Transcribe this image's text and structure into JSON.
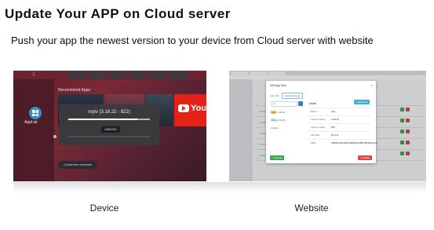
{
  "header": {
    "title": "Update Your APP on Cloud server",
    "subtitle": "Push your app the newest version to your device from Cloud server with website"
  },
  "device": {
    "caption": "Device",
    "applist_label": "AppList",
    "recommended_label": "Recommend Apps",
    "dialog": {
      "title": "mytv (3.18.22 - 822)",
      "cancel_label": "CANCEL",
      "progress": 0.85
    },
    "youtube_text": "YouT",
    "customize_label": "Customize channels"
  },
  "website": {
    "caption": "Website",
    "modal": {
      "title": "Edit App Item",
      "close": "×",
      "tabs": [
        "App Info",
        "Install Manager"
      ],
      "search_placeholder": "Al",
      "list": [
        {
          "badge": "App",
          "value": "2.18.22"
        },
        {
          "badge": "Test",
          "value": "2.18.22"
        },
        {
          "badge": "",
          "value": "2 items"
        }
      ],
      "detail_head": "Detail",
      "add_label": "+ Add New",
      "details": [
        {
          "k": "Mode",
          "v": "App"
        },
        {
          "k": "Version Name",
          "v": "3.18.22"
        },
        {
          "k": "Version Code",
          "v": "822"
        },
        {
          "k": "File Size",
          "v": "22.0 M"
        },
        {
          "k": "MD5",
          "v": "A9B3F6F0C3B2D4E5F6A7B8C9D0E1F2A3"
        }
      ],
      "save_label": "✓ Release",
      "delete_label": "✕ Delete"
    }
  }
}
